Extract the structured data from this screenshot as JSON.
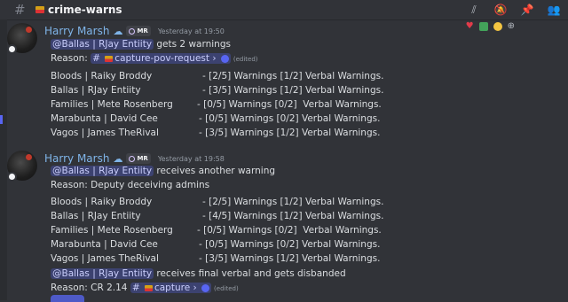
{
  "header": {
    "channel": "crime-warns",
    "icons": [
      "threads-icon",
      "mute-bell-icon",
      "pin-icon",
      "members-icon"
    ]
  },
  "reactions": [
    "heart",
    "check",
    "face",
    "more"
  ],
  "messages": [
    {
      "author": "Harry Marsh",
      "badge": "MR",
      "time": "Yesterday at 19:50",
      "headline_mention": "@Ballas | RJay Entiity",
      "headline_rest": " gets 2 warnings",
      "reason_label": "Reason: ",
      "reason_channel": "capture-pov-request",
      "edited": "(edited)",
      "rows": [
        {
          "name": "Bloods | Raiky Broddy",
          "status": "- [2/5] Warnings [1/2] Verbal Warnings."
        },
        {
          "name": "Ballas | RJay Entiity",
          "status": "- [3/5] Warnings [1/2] Verbal Warnings."
        },
        {
          "name": "Families | Mete Rosenberg",
          "status": "- [0/5] Warnings [0/2]  Verbal Warnings."
        },
        {
          "name": "Marabunta | David Cee",
          "status": "- [0/5] Warnings [0/2] Verbal Warnings."
        },
        {
          "name": "Vagos | James TheRival",
          "status": "- [3/5] Warnings [1/2] Verbal Warnings."
        }
      ]
    },
    {
      "author": "Harry Marsh",
      "badge": "MR",
      "time": "Yesterday at 19:58",
      "headline_mention": "@Ballas | RJay Entiity",
      "headline_rest": " receives another warning",
      "reason_text": "Reason: Deputy deceiving admins",
      "rows": [
        {
          "name": "Bloods | Raiky Broddy",
          "status": "- [2/5] Warnings [1/2] Verbal Warnings."
        },
        {
          "name": "Ballas | RJay Entiity",
          "status": "- [4/5] Warnings [1/2] Verbal Warnings."
        },
        {
          "name": "Families | Mete Rosenberg",
          "status": "- [0/5] Warnings [0/2]  Verbal Warnings."
        },
        {
          "name": "Marabunta | David Cee",
          "status": "- [0/5] Warnings [0/2] Verbal Warnings."
        },
        {
          "name": "Vagos | James TheRival",
          "status": "- [3/5] Warnings [1/2] Verbal Warnings."
        }
      ],
      "final_mention": "@Ballas | RJay Entiity",
      "final_rest": " receives final verbal and gets disbanded",
      "final_reason_label": "Reason: CR 2.14 ",
      "final_reason_channel": "capture",
      "final_edited": "(edited)"
    }
  ]
}
